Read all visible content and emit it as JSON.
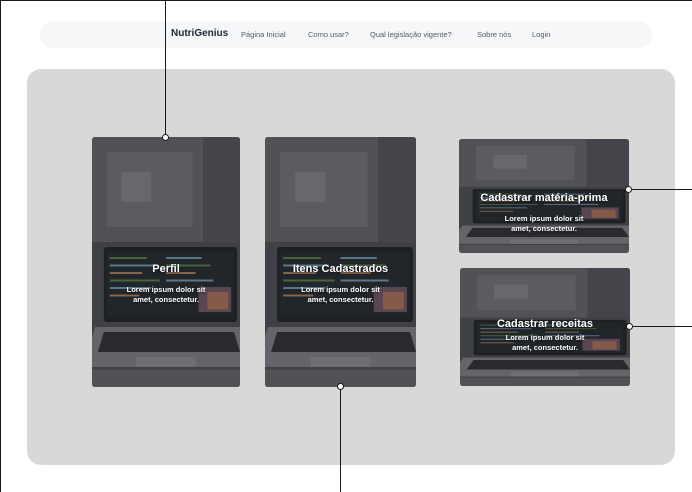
{
  "header": {
    "brand": "NutriGenius",
    "links": [
      {
        "label": "Página Inicial"
      },
      {
        "label": "Como usar?"
      },
      {
        "label": "Qual legislação vigente?"
      },
      {
        "label": "Sobre nós"
      },
      {
        "label": "Login"
      }
    ]
  },
  "cards": [
    {
      "title": "Perfil",
      "description": "Lorem ipsum dolor sit amet, consectetur."
    },
    {
      "title": "Itens Cadastrados",
      "description": "Lorem ipsum dolor sit amet, consectetur."
    },
    {
      "title": "Cadastrar matéria-prima",
      "description": "Lorem ipsum dolor sit amet, consectetur."
    },
    {
      "title": "Cadastrar receitas",
      "description": "Lorem ipsum dolor sit amet, consectetur."
    }
  ],
  "colors": {
    "page_background": "#ffffff",
    "navbar_background": "#f6f7f9",
    "panel_background": "#d8d8d8",
    "card_text": "#ffffff"
  }
}
